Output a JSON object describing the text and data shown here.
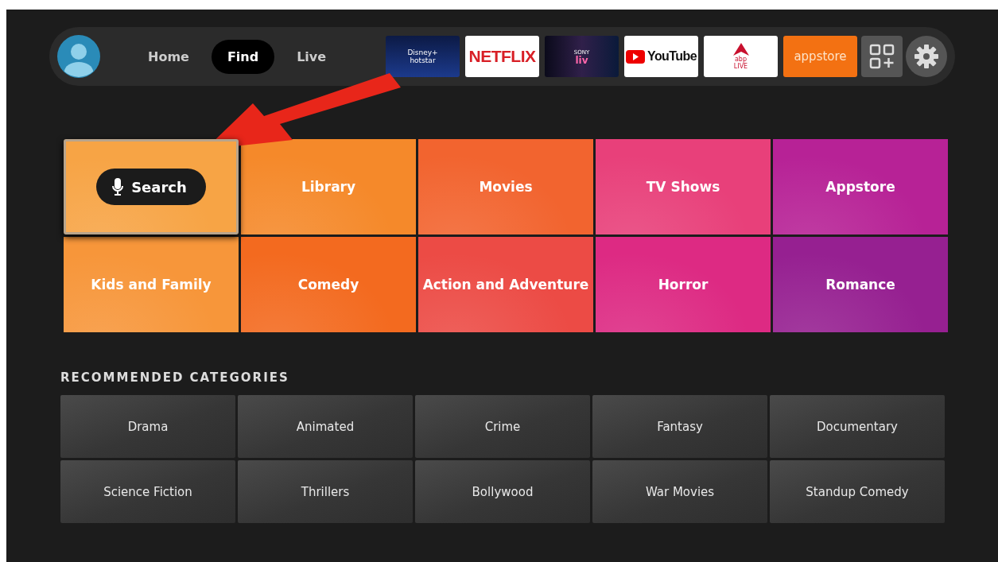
{
  "nav": {
    "tabs": [
      {
        "label": "Home",
        "selected": false
      },
      {
        "label": "Find",
        "selected": true
      },
      {
        "label": "Live",
        "selected": false
      }
    ]
  },
  "apps": [
    {
      "kind": "hotstar",
      "line1": "Disney+",
      "line2": "hotstar"
    },
    {
      "kind": "netflix",
      "line1": "NETFLIX"
    },
    {
      "kind": "sonyliv",
      "line1": "SONY",
      "line2": "liv"
    },
    {
      "kind": "youtube",
      "line1": "YouTube"
    },
    {
      "kind": "abp",
      "line1": "abp",
      "line2": "LIVE"
    },
    {
      "kind": "appstore",
      "line1": "appstore"
    }
  ],
  "tiles": [
    {
      "kind": "search",
      "label": "Search",
      "selected": true,
      "color": "#f7a445"
    },
    {
      "kind": "category",
      "label": "Library",
      "selected": false,
      "color": "#f5892a"
    },
    {
      "kind": "category",
      "label": "Movies",
      "selected": false,
      "color": "#f2642f"
    },
    {
      "kind": "category",
      "label": "TV Shows",
      "selected": false,
      "color": "#e8407a"
    },
    {
      "kind": "category",
      "label": "Appstore",
      "selected": false,
      "color": "#b72296"
    },
    {
      "kind": "category",
      "label": "Kids and Family",
      "selected": false,
      "color": "#f7963a"
    },
    {
      "kind": "category",
      "label": "Comedy",
      "selected": false,
      "color": "#f36a1f"
    },
    {
      "kind": "category",
      "label": "Action and Adventure",
      "selected": false,
      "color": "#ec4b45"
    },
    {
      "kind": "category",
      "label": "Horror",
      "selected": false,
      "color": "#dd2a83"
    },
    {
      "kind": "category",
      "label": "Romance",
      "selected": false,
      "color": "#962091"
    }
  ],
  "recommended": {
    "title": "RECOMMENDED CATEGORIES",
    "items": [
      "Drama",
      "Animated",
      "Crime",
      "Fantasy",
      "Documentary",
      "Science Fiction",
      "Thrillers",
      "Bollywood",
      "War Movies",
      "Standup Comedy"
    ]
  }
}
